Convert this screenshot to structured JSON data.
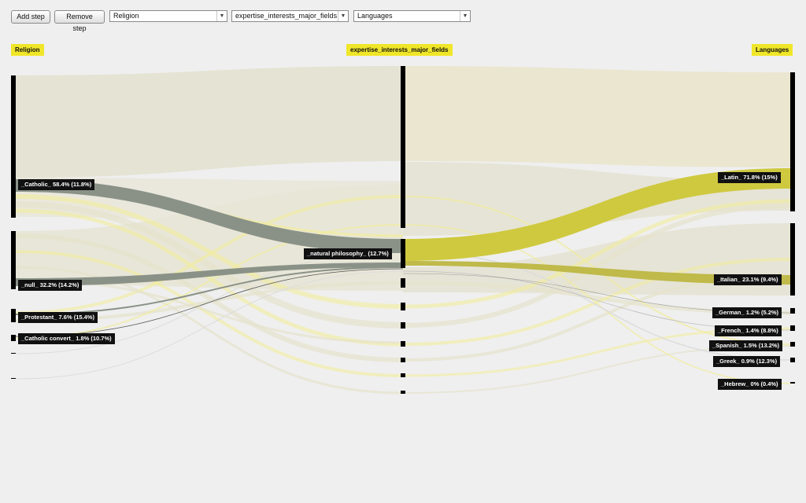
{
  "toolbar": {
    "add_step": "Add step",
    "remove_step": "Remove step",
    "selects": [
      "Religion",
      "expertise_interests_major_fields",
      "Languages"
    ]
  },
  "columns": {
    "left_title": "Religion",
    "mid_title": "expertise_interests_major_fields",
    "right_title": "Languages"
  },
  "left_nodes": [
    "_Catholic_ 58.4% (11.8%)",
    "_null_ 32.2% (14.2%)",
    "_Protestant_ 7.6% (15.4%)",
    "_Catholic convert_ 1.8% (10.7%)"
  ],
  "mid_node": "_natural philosophy_ (12.7%)",
  "right_nodes": [
    "_Latin_ 71.8% (15%)",
    "_Italian_ 23.1% (9.4%)",
    "_German_ 1.2% (5.2%)",
    "_French_ 1.4% (8.8%)",
    "_Spanish_ 1.5% (13.2%)",
    "_Greek_ 0.9% (12.3%)",
    "_Hebrew_ 0% (0.4%)"
  ],
  "colors": {
    "background": "#efefef",
    "title_bg": "#f0e629",
    "highlight_right": "#cfc93f",
    "highlight_left": "#8a9288",
    "flow_base": "#e3e1cf",
    "flow_yellow": "#f1ec9c"
  }
}
